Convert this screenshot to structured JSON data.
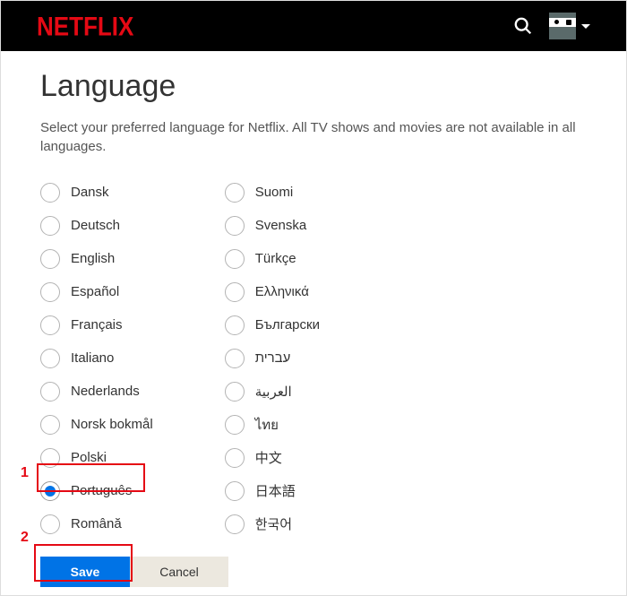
{
  "header": {
    "logo_text": "NETFLIX"
  },
  "page": {
    "title": "Language",
    "description": "Select your preferred language for Netflix. All TV shows and movies are not available in all languages."
  },
  "languages_col1": [
    {
      "label": "Dansk",
      "selected": false
    },
    {
      "label": "Deutsch",
      "selected": false
    },
    {
      "label": "English",
      "selected": false
    },
    {
      "label": "Español",
      "selected": false
    },
    {
      "label": "Français",
      "selected": false
    },
    {
      "label": "Italiano",
      "selected": false
    },
    {
      "label": "Nederlands",
      "selected": false
    },
    {
      "label": "Norsk bokmål",
      "selected": false
    },
    {
      "label": "Polski",
      "selected": false
    },
    {
      "label": "Português",
      "selected": true
    },
    {
      "label": "Română",
      "selected": false
    }
  ],
  "languages_col2": [
    {
      "label": "Suomi",
      "selected": false
    },
    {
      "label": "Svenska",
      "selected": false
    },
    {
      "label": "Türkçe",
      "selected": false
    },
    {
      "label": "Ελληνικά",
      "selected": false
    },
    {
      "label": "Български",
      "selected": false
    },
    {
      "label": "עברית",
      "selected": false
    },
    {
      "label": "العربية",
      "selected": false
    },
    {
      "label": "ไทย",
      "selected": false
    },
    {
      "label": "中文",
      "selected": false
    },
    {
      "label": "日本語",
      "selected": false
    },
    {
      "label": "한국어",
      "selected": false
    }
  ],
  "actions": {
    "save_label": "Save",
    "cancel_label": "Cancel"
  },
  "annotations": {
    "n1": "1",
    "n2": "2"
  }
}
